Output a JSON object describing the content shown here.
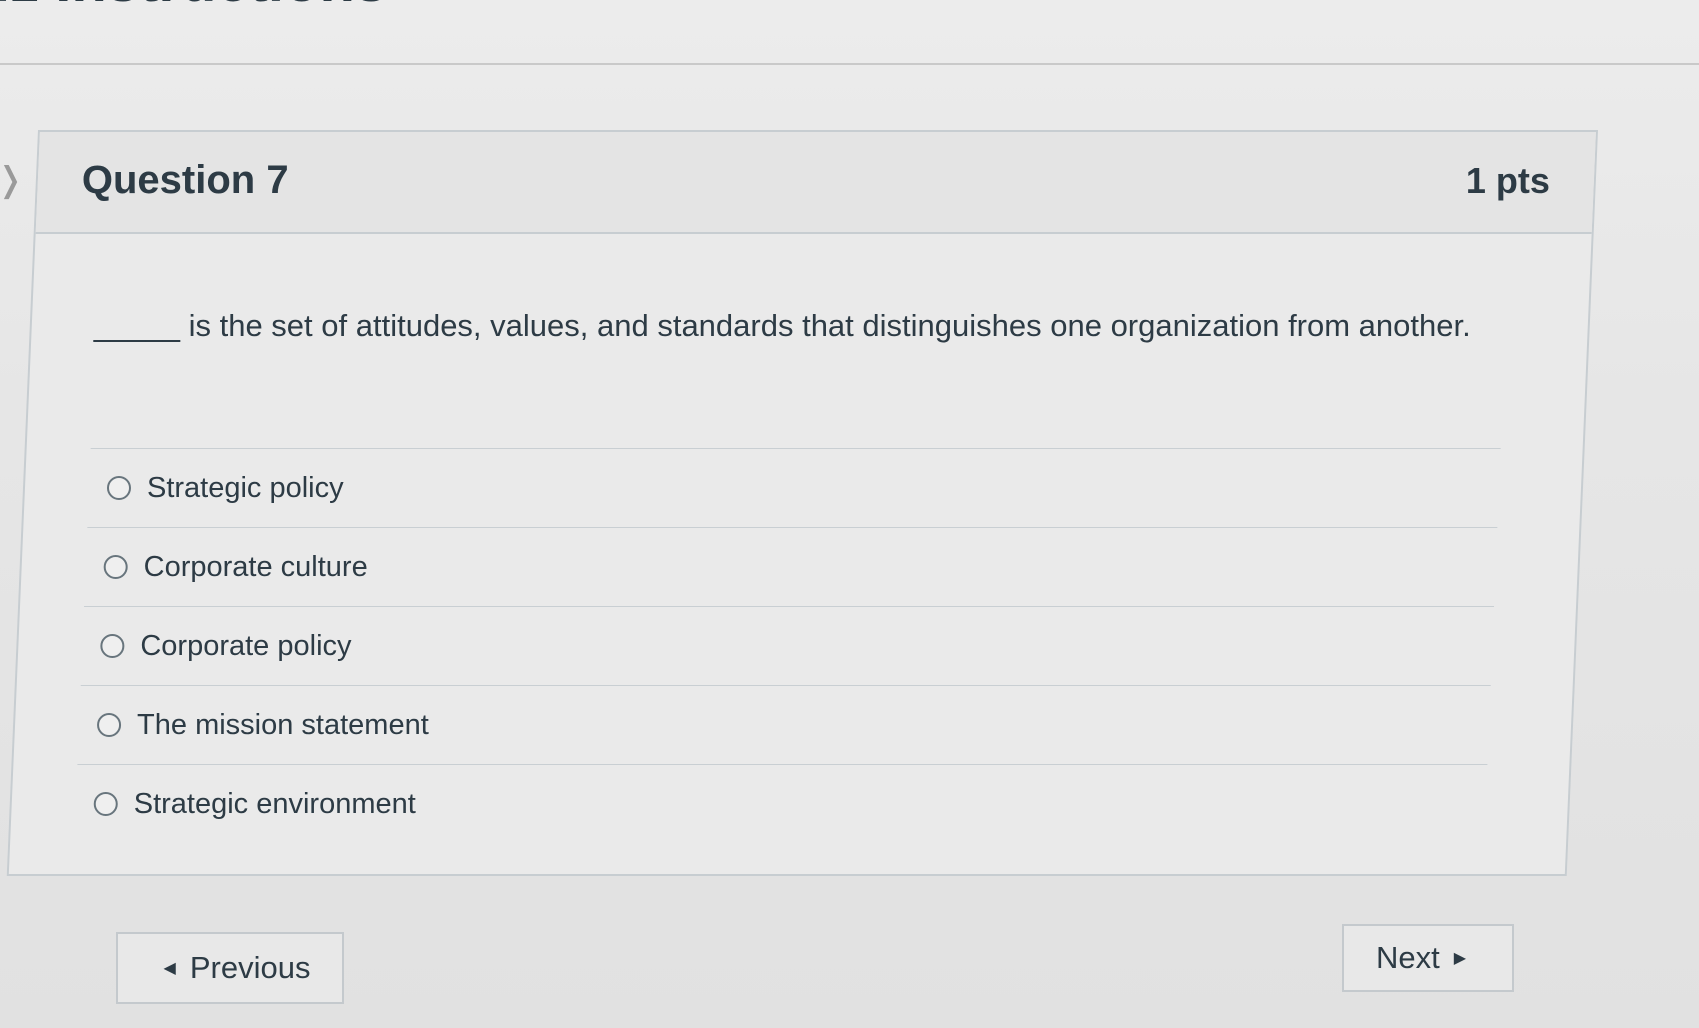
{
  "page": {
    "heading_fragment": "iz Instructions"
  },
  "question": {
    "title": "Question 7",
    "points": "1 pts",
    "text": "_____ is the set of attitudes, values, and standards that distinguishes one organization from another."
  },
  "answers": [
    {
      "label": "Strategic policy",
      "selected": false
    },
    {
      "label": "Corporate culture",
      "selected": false
    },
    {
      "label": "Corporate policy",
      "selected": false
    },
    {
      "label": "The mission statement",
      "selected": false
    },
    {
      "label": "Strategic environment",
      "selected": false
    }
  ],
  "navigation": {
    "previous_label": "Previous",
    "next_label": "Next"
  },
  "icons": {
    "previous": "triangle-left-icon",
    "next": "triangle-right-icon",
    "radio": "radio-unchecked-icon",
    "side": "chevron-right-icon"
  }
}
